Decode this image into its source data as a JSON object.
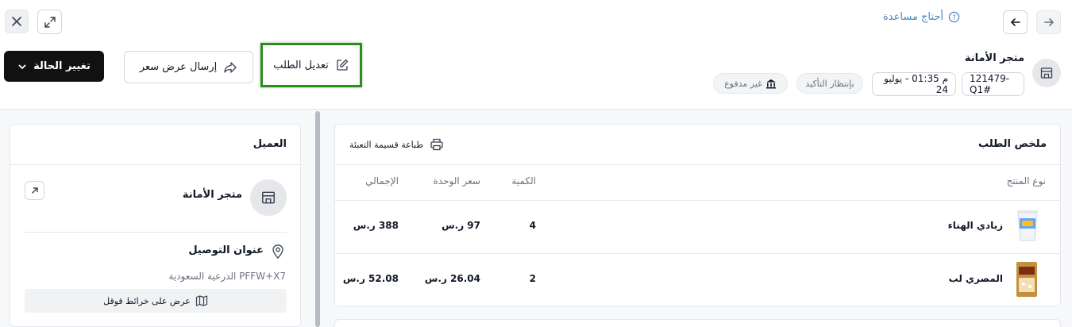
{
  "header": {
    "help_label": "أحتاج مساعدة",
    "store_name": "متجر الأمانة",
    "order_id": "121479-Q1#",
    "order_datetime": "م 01:35 - يوليو 24",
    "status_badge": "بإنتظار التأكيد",
    "payment_badge": "غير مدفوع"
  },
  "toolbar": {
    "edit_order_label": "تعديل الطلب",
    "send_quote_label": "إرسال عرض سعر",
    "change_status_label": "تغيير الحالة"
  },
  "order_summary": {
    "title": "ملخص الطلب",
    "print_label": "طباعة قسيمة التعبئة",
    "columns": {
      "product": "نوع المنتج",
      "quantity": "الكمية",
      "unit_price": "سعر الوحدة",
      "total": "الإجمالي"
    },
    "rows": [
      {
        "name": "زبادي الهناء",
        "quantity": "4",
        "unit_price": "97 ر.س",
        "total": "388 ر.س"
      },
      {
        "name": "المصري لب",
        "quantity": "2",
        "unit_price": "26.04 ر.س",
        "total": "52.08 ر.س"
      }
    ]
  },
  "customer": {
    "title": "العميل",
    "name": "متجر الأمانة",
    "address_title": "عنوان التوصيل",
    "address": "PFFW+X7 الدرعية السعودية",
    "map_label": "عرض على خرائط قوقل"
  },
  "colors": {
    "accent_link": "#4a86c5",
    "highlight_border": "#2e8b22",
    "dark_button": "#111111"
  }
}
